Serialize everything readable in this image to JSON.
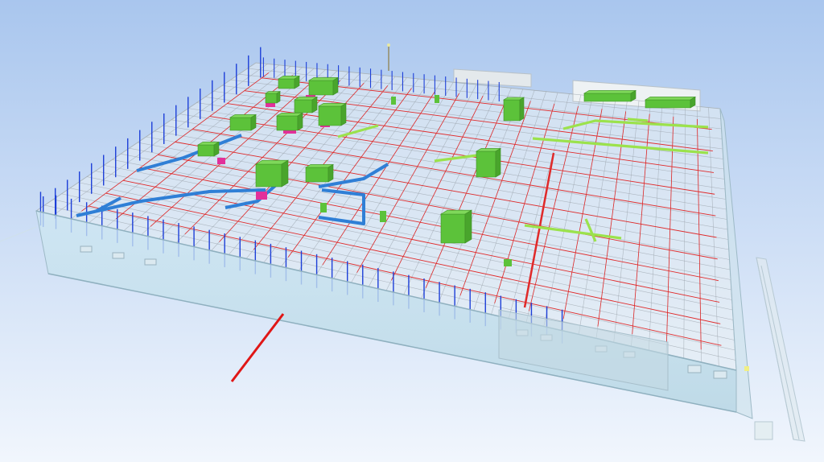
{
  "viewport": {
    "background_top": "#a9c6ee",
    "background_bottom": "#f1f6fd"
  },
  "scene": {
    "glass_wall_color": "#cfe8f2",
    "roof_grid_gray": "#9aa3ab",
    "cable_tray_red": "#e02a2a",
    "column_blue": "#1d3fd8",
    "duct_blue": "#2f7fd6",
    "equipment_green": "#5cc23a",
    "pipe_lime": "#9be24c",
    "pipe_pink": "#e2309a",
    "axis_red": "#e01616"
  }
}
